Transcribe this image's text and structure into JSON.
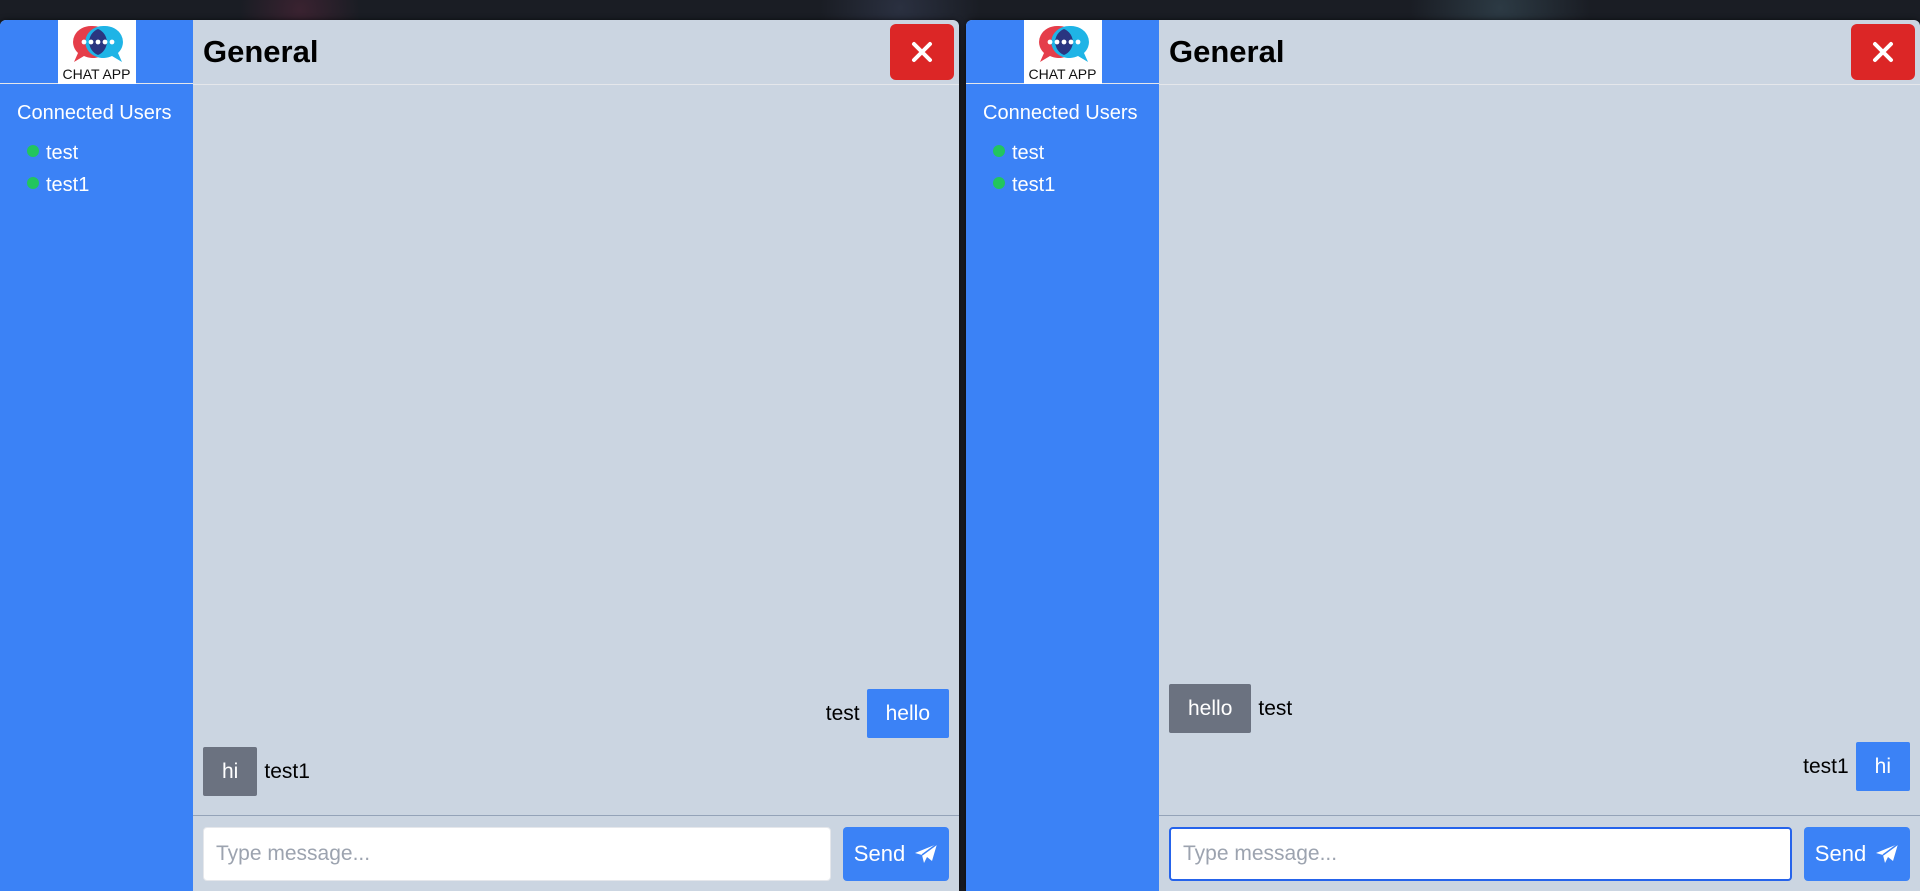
{
  "windows": [
    {
      "logo_text": "CHAT APP",
      "sidebar_title": "Connected Users",
      "users": [
        "test",
        "test1"
      ],
      "room_title": "General",
      "messages": [
        {
          "sender": "test",
          "text": "hello",
          "side": "right"
        },
        {
          "sender": "test1",
          "text": "hi",
          "side": "left"
        }
      ],
      "input": {
        "placeholder": "Type message...",
        "value": ""
      },
      "send_label": "Send"
    },
    {
      "logo_text": "CHAT APP",
      "sidebar_title": "Connected Users",
      "users": [
        "test",
        "test1"
      ],
      "room_title": "General",
      "messages": [
        {
          "sender": "test",
          "text": "hello",
          "side": "left"
        },
        {
          "sender": "test1",
          "text": "hi",
          "side": "right"
        }
      ],
      "input": {
        "placeholder": "Type message...",
        "value": ""
      },
      "send_label": "Send"
    }
  ],
  "colors": {
    "sidebar": "#3b82f6",
    "chat_bg": "#cbd5e1",
    "close": "#dc2626",
    "own_bubble": "#3b82f6",
    "other_bubble": "#6b7280",
    "online": "#22c55e"
  },
  "icons": [
    "chat-logo-icon",
    "close-icon",
    "paper-plane-icon",
    "online-dot-icon"
  ]
}
